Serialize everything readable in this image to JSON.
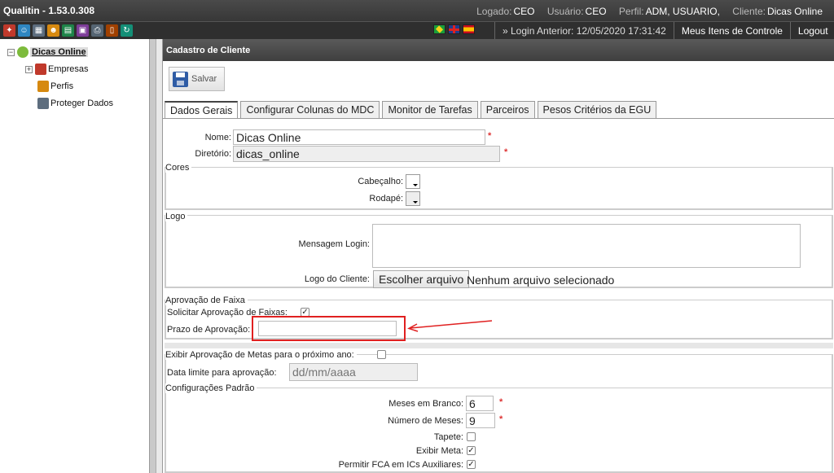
{
  "app": {
    "title": "Qualitin - 1.53.0.308",
    "session": {
      "logado_label": "Logado:",
      "logado_value": "CEO",
      "usuario_label": "Usuário:",
      "usuario_value": "CEO",
      "perfil_label": "Perfil:",
      "perfil_value": "ADM, USUARIO,",
      "cliente_label": "Cliente:",
      "cliente_value": "Dicas Online"
    },
    "login_anterior": "» Login Anterior: 12/05/2020 17:31:42",
    "nav": {
      "meus_itens": "Meus Itens de Controle",
      "logout": "Logout"
    },
    "toolbar_icons": [
      "tools-icon",
      "users-icon",
      "calendar-icon",
      "people-icon",
      "chart-icon",
      "report-icon",
      "print-icon",
      "book-icon",
      "refresh-icon"
    ],
    "flags": [
      "brazil-flag-icon",
      "uk-flag-icon",
      "spain-flag-icon"
    ]
  },
  "sidebar": {
    "root": "Dicas Online",
    "items": [
      {
        "label": "Empresas",
        "icon": "tools-icon"
      },
      {
        "label": "Perfis",
        "icon": "people-icon"
      },
      {
        "label": "Proteger Dados",
        "icon": "calendar-icon"
      }
    ]
  },
  "panel": {
    "title": "Cadastro de Cliente",
    "save_label": "Salvar",
    "tabs": [
      "Dados Gerais",
      "Configurar Colunas do MDC",
      "Monitor de Tarefas",
      "Parceiros",
      "Pesos Critérios da EGU"
    ]
  },
  "form": {
    "nome_label": "Nome:",
    "nome_value": "Dicas Online",
    "diretorio_label": "Diretório:",
    "diretorio_value": "dicas_online",
    "required_mark": "*",
    "cores": {
      "legend": "Cores",
      "cabecalho_label": "Cabeçalho:",
      "rodape_label": "Rodapé:"
    },
    "logo": {
      "legend": "Logo",
      "mensagem_label": "Mensagem Login:",
      "logo_cliente_label": "Logo do Cliente:",
      "file_button": "Escolher arquivo",
      "file_status": "Nenhum arquivo selecionado"
    },
    "aprovacao": {
      "legend": "Aprovação de Faixa",
      "solicitar_label": "Solicitar Aprovação de Faixas:",
      "solicitar_checked": true,
      "prazo_label": "Prazo de Aprovação:",
      "prazo_value": ""
    },
    "metas": {
      "exibir_label": "Exibir Aprovação de Metas para o próximo ano:",
      "exibir_checked": false,
      "data_limite_label": "Data limite para aprovação:",
      "data_limite_placeholder": "dd/mm/aaaa"
    },
    "config": {
      "legend": "Configurações Padrão",
      "meses_branco_label": "Meses em Branco:",
      "meses_branco_value": "6",
      "numero_meses_label": "Número de Meses:",
      "numero_meses_value": "9",
      "tapete_label": "Tapete:",
      "tapete_checked": false,
      "exibir_meta_label": "Exibir Meta:",
      "exibir_meta_checked": true,
      "permitir_fca_label": "Permitir FCA em ICs Auxiliares:",
      "permitir_fca_checked": true
    },
    "check_mark": "✓"
  }
}
